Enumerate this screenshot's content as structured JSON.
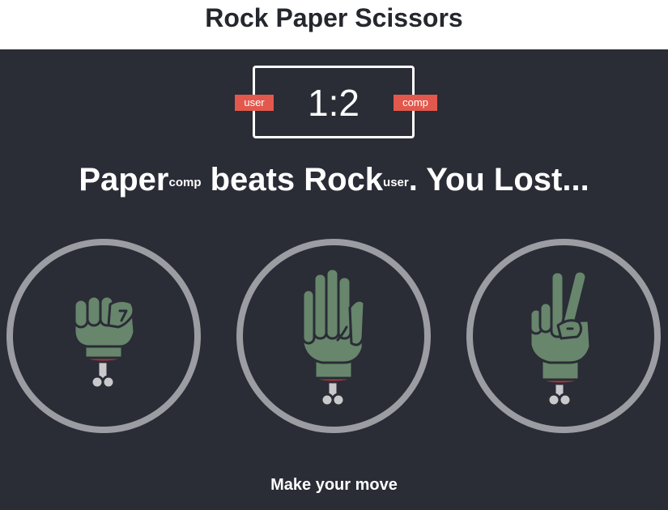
{
  "header": {
    "title": "Rock Paper Scissors"
  },
  "score": {
    "text": "1:2",
    "user_label": "user",
    "comp_label": "comp"
  },
  "result": {
    "winner": "Paper",
    "winner_tag": "comp",
    "middle": " beats ",
    "loser": "Rock",
    "loser_tag": "user",
    "suffix": ". You Lost..."
  },
  "choices": [
    {
      "name": "rock",
      "icon": "fist-hand-icon"
    },
    {
      "name": "paper",
      "icon": "open-hand-icon"
    },
    {
      "name": "scissors",
      "icon": "peace-hand-icon"
    }
  ],
  "prompt": "Make your move",
  "colors": {
    "board_bg": "#2a2c36",
    "badge": "#e2584d",
    "hand": "#67866c",
    "ring": "#9c9da2"
  }
}
